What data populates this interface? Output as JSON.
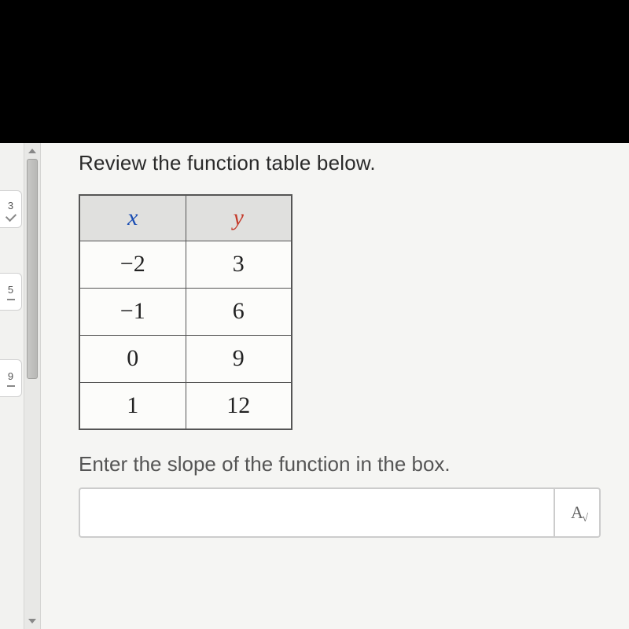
{
  "question": {
    "prompt": "Review the function table below.",
    "instruction": "Enter the slope of the function in the box."
  },
  "table": {
    "headers": {
      "x": "x",
      "y": "y"
    },
    "rows": [
      {
        "x": "−2",
        "y": "3"
      },
      {
        "x": "−1",
        "y": "6"
      },
      {
        "x": "0",
        "y": "9"
      },
      {
        "x": "1",
        "y": "12"
      }
    ]
  },
  "input": {
    "value": "",
    "placeholder": ""
  },
  "math_toggle_label": "A",
  "chart_data": {
    "type": "table",
    "title": "Function table",
    "columns": [
      "x",
      "y"
    ],
    "data": [
      [
        -2,
        3
      ],
      [
        -1,
        6
      ],
      [
        0,
        9
      ],
      [
        1,
        12
      ]
    ]
  }
}
